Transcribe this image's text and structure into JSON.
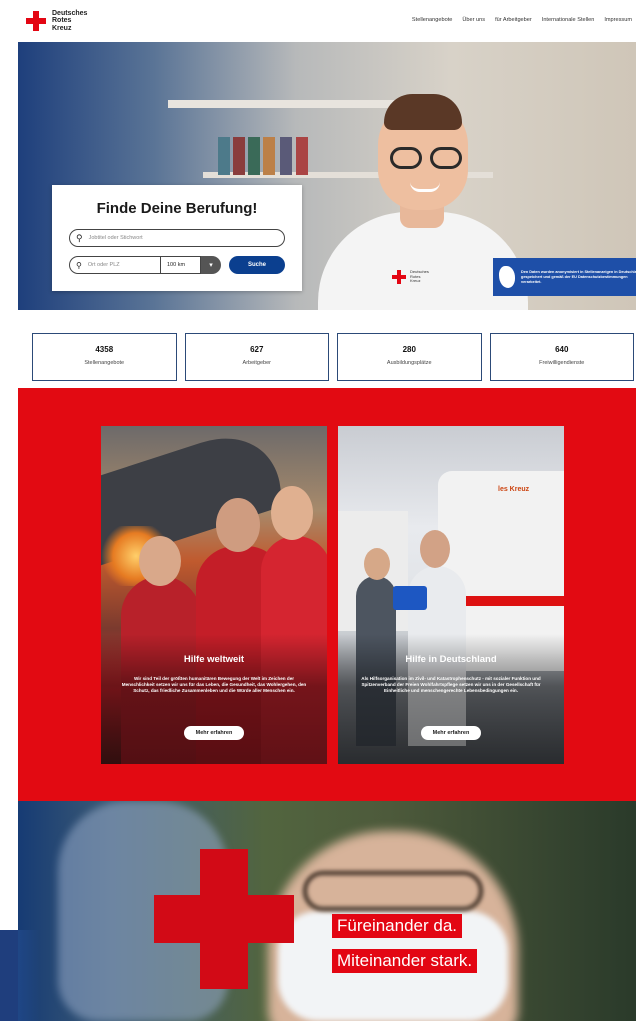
{
  "header": {
    "logo_lines": [
      "Deutsches",
      "Rotes",
      "Kreuz"
    ],
    "nav": [
      "Stellenangebote",
      "Über uns",
      "für Arbeitgeber",
      "Internationale Stellen",
      "Impressum"
    ]
  },
  "hero": {
    "search_title": "Finde Deine Berufung!",
    "keyword_placeholder": "Jobtitel oder Stichwort",
    "location_placeholder": "Ort oder PLZ",
    "radius_value": "100 km",
    "search_button": "Suche",
    "shirt_lines": [
      "Deutsches",
      "Rotes",
      "Kreuz"
    ],
    "notice_text": "Den Daten wurden anonymisiert in Stellenanzeigen in Deutschland gespeichert und gemäß der EU Datenschutzbestimmungen verarbeitet."
  },
  "stats": [
    {
      "number": "4358",
      "label": "Stellenangebote"
    },
    {
      "number": "627",
      "label": "Arbeitgeber"
    },
    {
      "number": "280",
      "label": "Ausbildungsplätze"
    },
    {
      "number": "640",
      "label": "Freiwilligendienste"
    }
  ],
  "cards": [
    {
      "title": "Hilfe weltweit",
      "text": "Wir sind Teil der größten humanitären Bewegung der Welt im Zeichen der Menschlichkeit setzen wir uns für das Leben, die Gesundheit, das Wohlergehen, den Schutz, das friedliche Zusammenleben und die Würde aller Menschen ein.",
      "button": "Mehr erfahren"
    },
    {
      "title": "Hilfe in Deutschland",
      "text": "Als Hilfsorganisation im Zivil- und Katastrophenschutz - mit sozialer Funktion und Spitzenverband der Freien Wohlfahrtspflege setzen wir uns in der Gesellschaft für Einheitliche und menschengerechte Lebensbedingungen ein.",
      "button": "Mehr erfahren",
      "van_text": "les Kreuz"
    }
  ],
  "banner": {
    "line1": "Füreinander da.",
    "line2": "Miteinander stark."
  },
  "colors": {
    "brand_red": "#e30613",
    "navy": "#0b3f8f"
  }
}
